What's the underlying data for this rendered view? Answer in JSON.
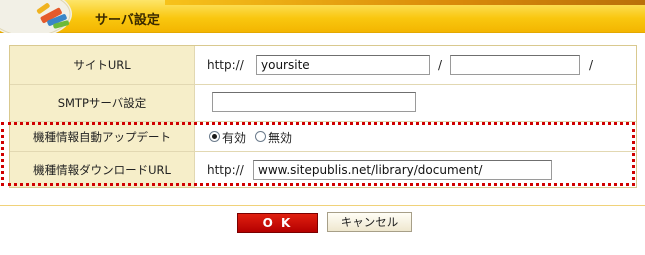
{
  "header": {
    "title": "サーバ設定",
    "accent_color": "#f9c70f"
  },
  "form": {
    "site_url": {
      "label": "サイトURL",
      "scheme": "http://",
      "host_value": "yoursite",
      "separator": "/",
      "path_value": "",
      "trailing_slash": "/"
    },
    "smtp": {
      "label": "SMTPサーバ設定",
      "value": ""
    },
    "auto_update": {
      "label": "機種情報自動アップデート",
      "options": [
        {
          "label": "有効",
          "selected": true
        },
        {
          "label": "無効",
          "selected": false
        }
      ]
    },
    "download_url": {
      "label": "機種情報ダウンロードURL",
      "scheme": "http://",
      "value": "www.sitepublis.net/library/document/"
    }
  },
  "buttons": {
    "ok_label": "O K",
    "cancel_label": "キャンセル",
    "ok_color": "#cc0000"
  },
  "highlight_color": "#d00000"
}
